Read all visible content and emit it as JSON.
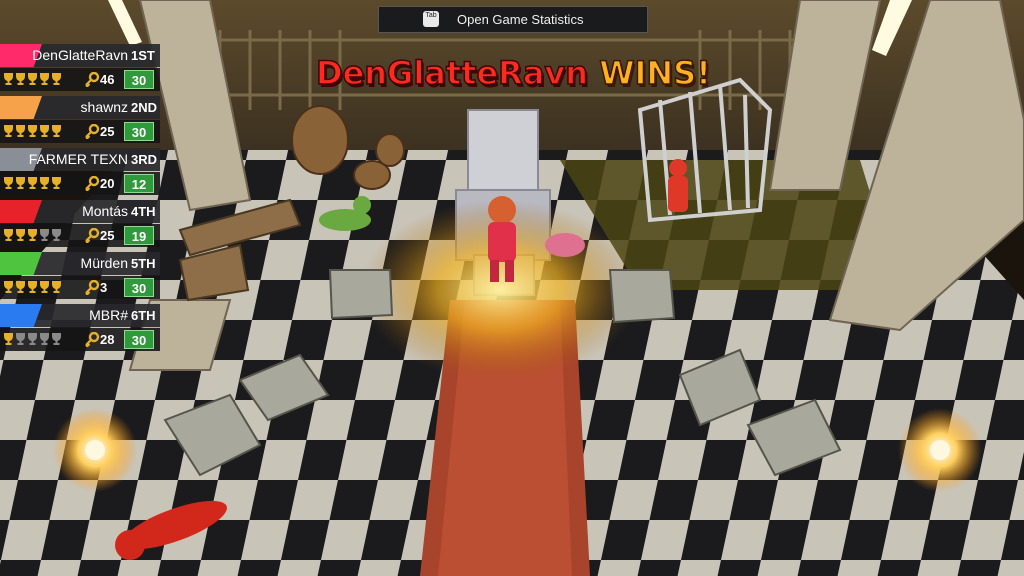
{
  "hud": {
    "stats_button": {
      "key_label": "Tab",
      "label": "Open Game Statistics"
    },
    "banner": {
      "winner_name": "DenGlatteRavn",
      "wins_text": "WINS!"
    }
  },
  "colors": {
    "place_1": "#ff2a6a",
    "place_2": "#f6a24a",
    "place_3": "#8a8e96",
    "place_4": "#e8222a",
    "place_5": "#4fc43e",
    "place_6": "#2b7bf0",
    "coins_bg": "#2f9a3b",
    "trophy_gold": "#e6b02a",
    "trophy_grey": "#8a8a8a"
  },
  "scoreboard": [
    {
      "name": "DenGlatteRavn",
      "place": "1ST",
      "trophies_won": 5,
      "trophies_total": 5,
      "keys": "46",
      "coins": "30"
    },
    {
      "name": "shawnz",
      "place": "2ND",
      "trophies_won": 5,
      "trophies_total": 5,
      "keys": "25",
      "coins": "30"
    },
    {
      "name": "FARMER TEXN",
      "place": "3RD",
      "trophies_won": 5,
      "trophies_total": 5,
      "keys": "20",
      "coins": "12"
    },
    {
      "name": "Montás",
      "place": "4TH",
      "trophies_won": 3,
      "trophies_total": 5,
      "keys": "25",
      "coins": "19"
    },
    {
      "name": "Mürden",
      "place": "5TH",
      "trophies_won": 5,
      "trophies_total": 5,
      "keys": "3",
      "coins": "30"
    },
    {
      "name": "MBR#",
      "place": "6TH",
      "trophies_won": 1,
      "trophies_total": 5,
      "keys": "28",
      "coins": "30"
    }
  ]
}
